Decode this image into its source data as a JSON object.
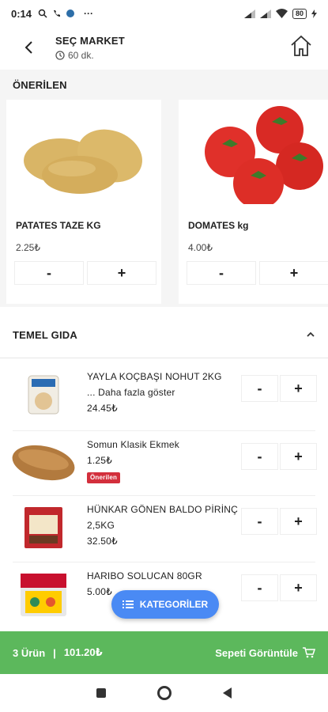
{
  "status_bar": {
    "time": "0:14",
    "battery": "80",
    "icons": [
      "search-icon",
      "wifi-calling-icon",
      "app-icon",
      "more-icon",
      "signal-icon",
      "signal-icon",
      "wifi-icon",
      "battery-icon",
      "charging-icon"
    ]
  },
  "header": {
    "store_name": "SEÇ MARKET",
    "eta": "60 dk.",
    "icons": [
      "back-arrow-icon",
      "clock-icon",
      "home-icon"
    ]
  },
  "recommended": {
    "title": "ÖNERİLEN",
    "products": [
      {
        "name": "PATATES TAZE KG",
        "price": "2.25₺",
        "minus": "-",
        "plus": "+"
      },
      {
        "name": "DOMATES kg",
        "price": "4.00₺",
        "minus": "-",
        "plus": "+"
      }
    ]
  },
  "category": {
    "title": "TEMEL GIDA",
    "items": [
      {
        "name": "YAYLA KOÇBAŞI NOHUT 2KG",
        "more": "... Daha fazla göster",
        "price": "24.45₺",
        "badge": "",
        "minus": "-",
        "plus": "+"
      },
      {
        "name": "Somun Klasik Ekmek",
        "more": "",
        "price": "1.25₺",
        "badge": "Önerilen",
        "minus": "-",
        "plus": "+"
      },
      {
        "name": "HÜNKAR GÖNEN BALDO PİRİNÇ",
        "more": "2,5KG",
        "price": "32.50₺",
        "badge": "",
        "minus": "-",
        "plus": "+"
      },
      {
        "name": "HARIBO SOLUCAN 80GR",
        "more": "",
        "price": "5.00₺",
        "badge": "",
        "minus": "-",
        "plus": "+"
      }
    ]
  },
  "categories_button": {
    "label": "KATEGORİLER"
  },
  "cart": {
    "count": "3 Ürün",
    "separator": "|",
    "total": "101.20₺",
    "view_label": "Sepeti Görüntüle"
  },
  "colors": {
    "cart_green": "#5cb85c",
    "categories_blue": "#4a8af4",
    "badge_red": "#d32f3c"
  }
}
